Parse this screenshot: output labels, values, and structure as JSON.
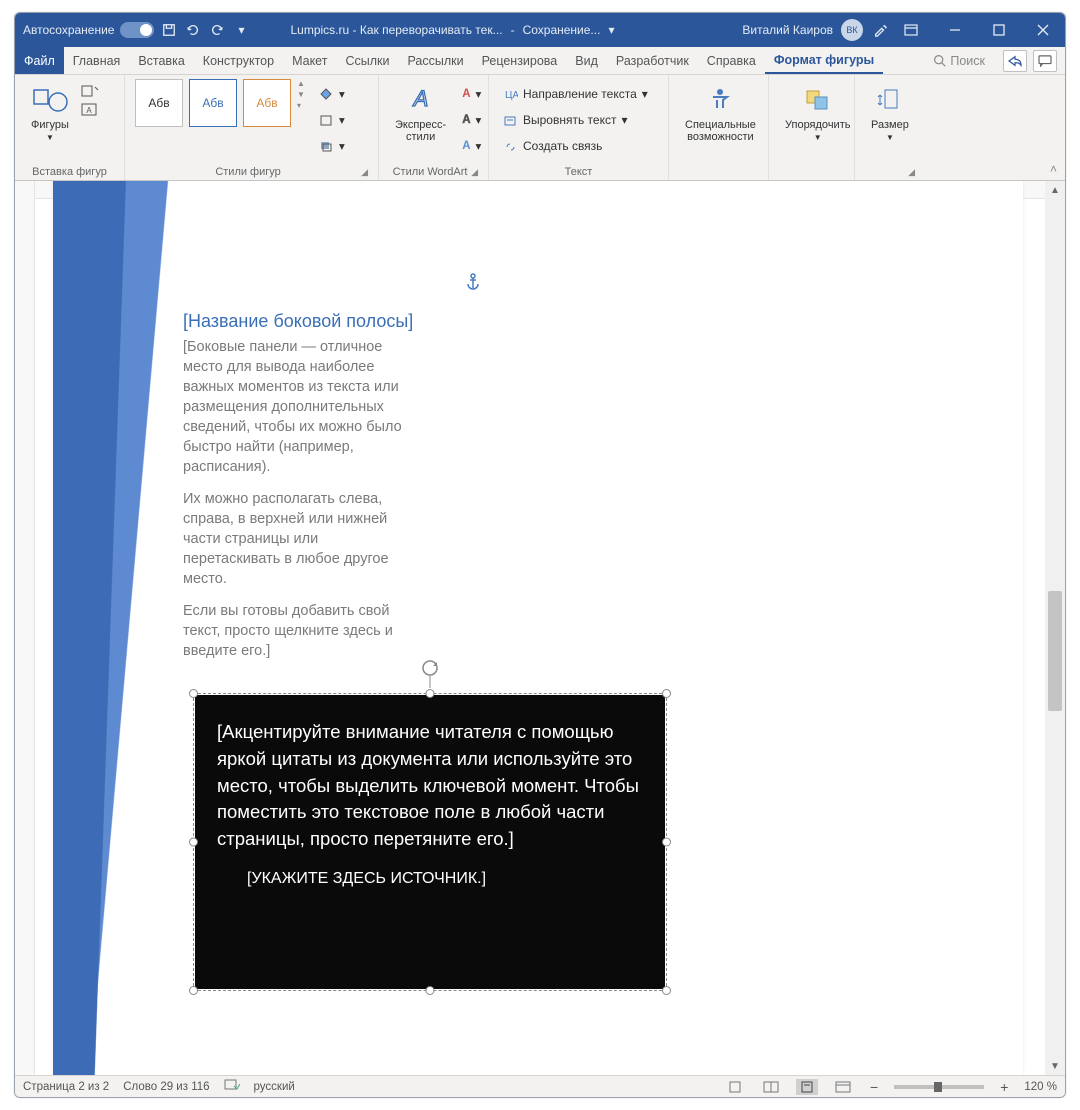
{
  "titlebar": {
    "autosave_label": "Автосохранение",
    "doc_title": "Lumpics.ru - Как переворачивать тек...",
    "saving": "Сохранение...",
    "user": "Виталий Каиров",
    "user_initials": "ВК"
  },
  "tabs": {
    "file": "Файл",
    "items": [
      "Главная",
      "Вставка",
      "Конструктор",
      "Макет",
      "Ссылки",
      "Рассылки",
      "Рецензирова",
      "Вид",
      "Разработчик",
      "Справка"
    ],
    "active": "Формат фигуры",
    "search_placeholder": "Поиск"
  },
  "ribbon": {
    "shapes_label": "Фигуры",
    "insert_group": "Вставка фигур",
    "style_sample": "Абв",
    "styles_group": "Стили фигур",
    "wordart_btn": "Экспресс-стили",
    "wordart_group": "Стили WordArt",
    "text_direction": "Направление текста",
    "text_align": "Выровнять текст",
    "text_link": "Создать связь",
    "text_group": "Текст",
    "a11y_btn": "Специальные возможности",
    "arrange_btn": "Упорядочить",
    "size_btn": "Размер"
  },
  "doc": {
    "sidebar_title": "[Название боковой полосы]",
    "sidebar_p1": "[Боковые панели — отличное место для вывода наиболее важных моментов из текста или размещения дополнительных сведений, чтобы их можно было быстро найти (например, расписания).",
    "sidebar_p2": "Их можно располагать слева, справа, в верхней или нижней части страницы или перетаскивать в любое другое место.",
    "sidebar_p3": "Если вы готовы добавить свой текст, просто щелкните здесь и введите его.]",
    "quote": "[Акцентируйте внимание читателя с помощью яркой цитаты из документа или используйте это место, чтобы выделить ключевой момент. Чтобы поместить это текстовое поле в любой части страницы, просто перетяните его.]",
    "source": "[УКАЖИТЕ ЗДЕСЬ ИСТОЧНИК.]"
  },
  "status": {
    "page": "Страница 2 из 2",
    "words": "Слово 29 из 116",
    "lang": "русский",
    "zoom": "120 %"
  }
}
